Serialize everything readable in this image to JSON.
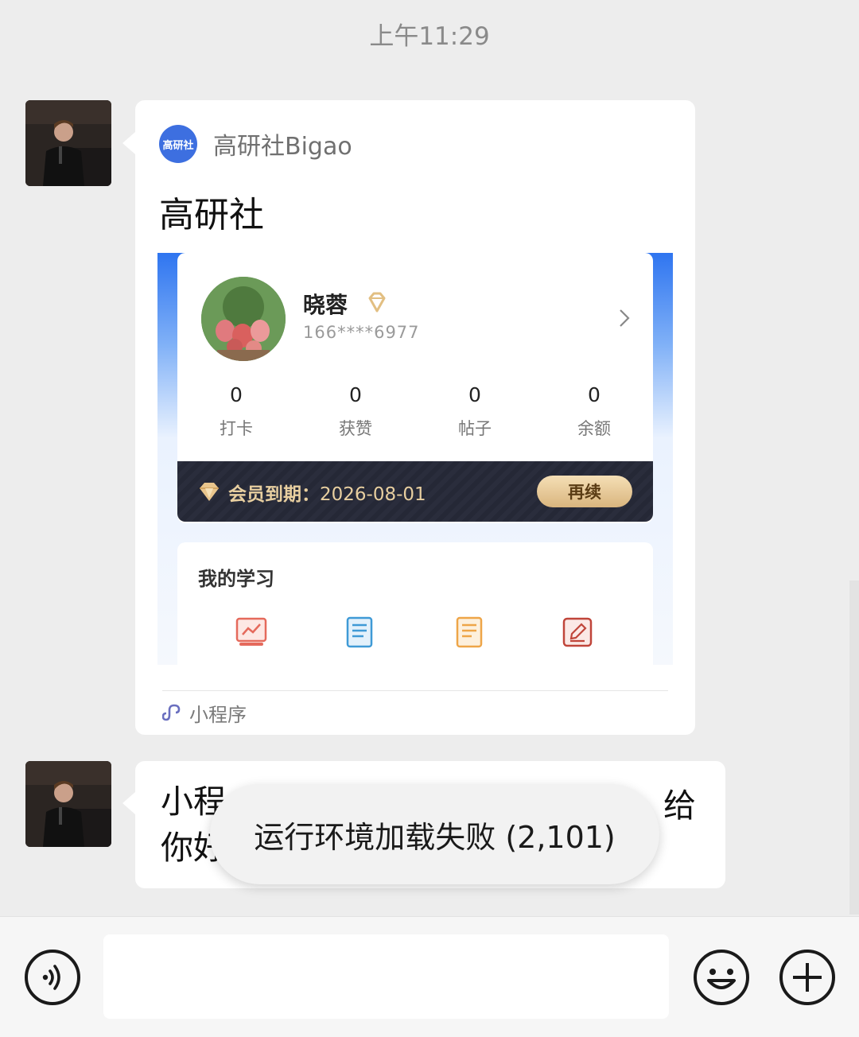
{
  "chat": {
    "timestamp": "上午11:29"
  },
  "mini_program_card": {
    "brand_logo_text": "高研社",
    "brand_name": "高研社Bigao",
    "title": "高研社",
    "footer_label": "小程序",
    "footer_icon": "mini-program-link-icon"
  },
  "preview": {
    "profile": {
      "name": "晓蓉",
      "phone": "166****6977"
    },
    "stats": [
      {
        "value": "0",
        "label": "打卡"
      },
      {
        "value": "0",
        "label": "获赞"
      },
      {
        "value": "0",
        "label": "帖子"
      },
      {
        "value": "0",
        "label": "余额"
      }
    ],
    "membership": {
      "label": "会员到期：",
      "expiry": "2026-08-01",
      "renew_label": "再续"
    },
    "study": {
      "title": "我的学习",
      "icons": [
        "study-plan-icon",
        "notes-book-icon",
        "my-documents-icon",
        "edit-note-icon"
      ]
    }
  },
  "message2": {
    "visible_left_line1": "小程",
    "visible_left_line2": "你好",
    "visible_right_line1": "给"
  },
  "toast": {
    "text": "运行环境加载失败 (2,101)"
  },
  "input_bar": {
    "placeholder": ""
  },
  "colors": {
    "brand_blue": "#3d6fe0",
    "member_gold": "#e8cfa0",
    "background": "#ededed"
  }
}
